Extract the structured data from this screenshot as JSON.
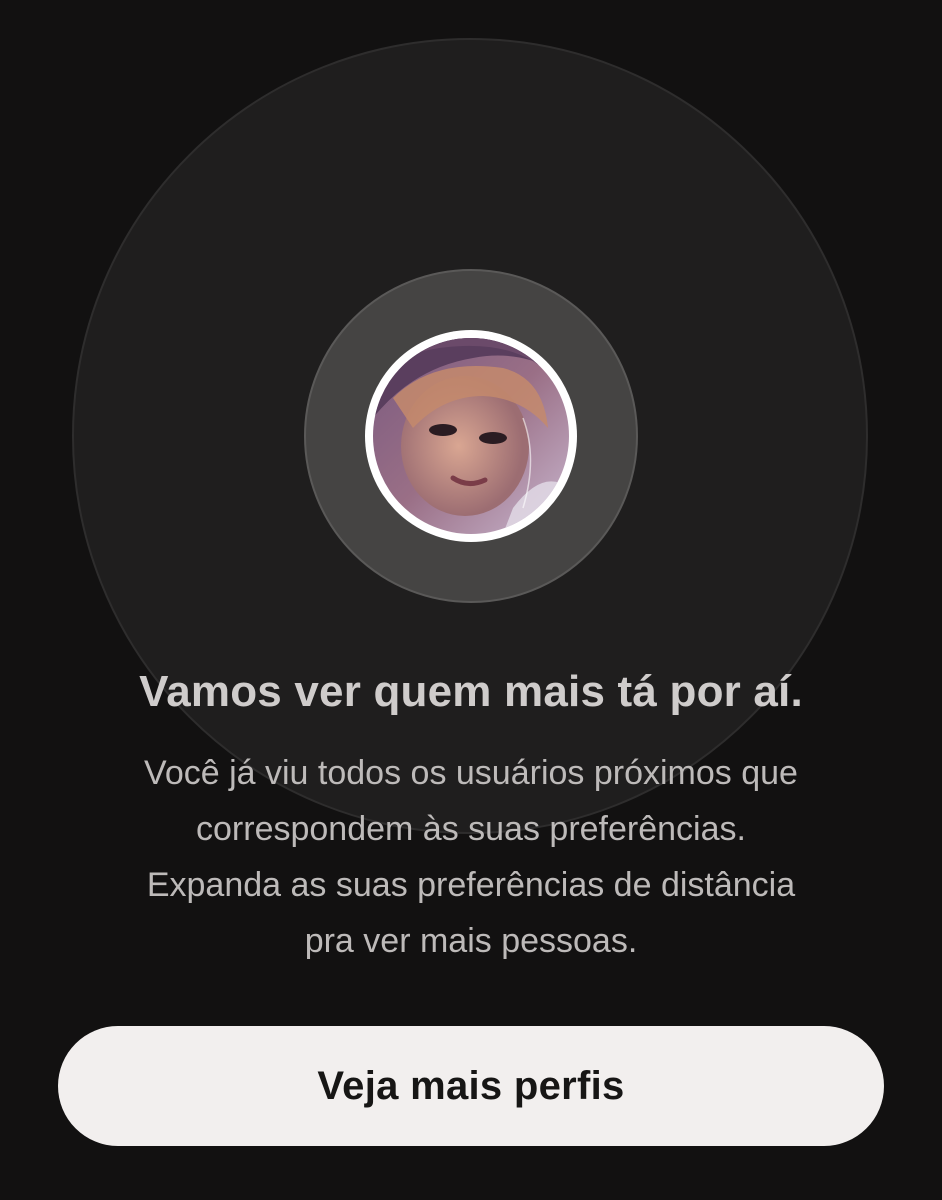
{
  "empty_state": {
    "title": "Vamos ver quem mais tá por aí.",
    "description_lines": [
      "Você já viu todos os usuários próximos que",
      "correspondem às suas preferências.",
      "Expanda as suas preferências de distância",
      "pra ver mais pessoas."
    ],
    "avatar_icon": "user-photo"
  },
  "actions": {
    "more_profiles_label": "Veja mais perfis"
  },
  "colors": {
    "background": "#121111",
    "button_background": "#f2efee",
    "button_text": "#171615"
  }
}
